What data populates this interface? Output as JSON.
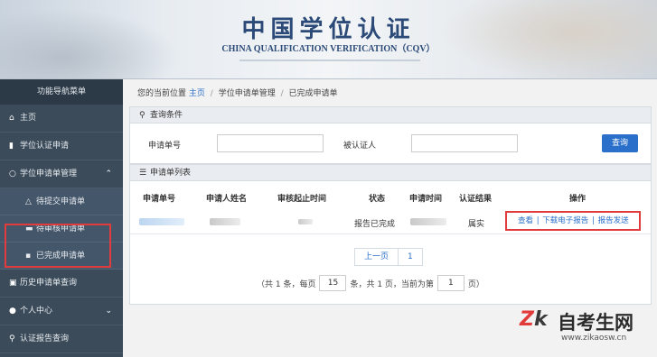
{
  "header": {
    "title_cn": "中国学位认证",
    "title_en": "CHINA QUALIFICATION VERIFICATION（CQV）"
  },
  "sidebar": {
    "heading": "功能导航菜单",
    "items": [
      {
        "label": "主页",
        "icon": "home-icon"
      },
      {
        "label": "学位认证申请",
        "icon": "document-icon"
      },
      {
        "label": "学位申请单管理",
        "icon": "circle-icon",
        "expanded": true
      },
      {
        "label": "历史申请单查询",
        "icon": "history-icon"
      },
      {
        "label": "个人中心",
        "icon": "user-icon"
      },
      {
        "label": "认证报告查询",
        "icon": "search-icon"
      }
    ],
    "subitems": [
      {
        "label": "待提交申请单",
        "icon": "warning-icon"
      },
      {
        "label": "待审核申请单",
        "icon": "pending-icon"
      },
      {
        "label": "已完成申请单",
        "icon": "done-icon"
      }
    ]
  },
  "breadcrumb": {
    "prefix": "您的当前位置",
    "home": "主页",
    "level2": "学位申请单管理",
    "current": "已完成申请单"
  },
  "query": {
    "panel_title": "查询条件",
    "field1_label": "申请单号",
    "field2_label": "被认证人",
    "button": "查询"
  },
  "list": {
    "panel_title": "申请单列表",
    "columns": [
      "申请单号",
      "申请人姓名",
      "审核起止时间",
      "状态",
      "申请时间",
      "认证结果",
      "操作"
    ],
    "row": {
      "status": "报告已完成",
      "result": "属实",
      "ops": [
        "查看",
        "下载电子报告",
        "报告发送"
      ]
    }
  },
  "pager": {
    "prev": "上一页",
    "current": "1",
    "info_a": "（共 1 条，每页",
    "per_page": "15",
    "info_b": "条，共 1 页，当前为第",
    "page": "1",
    "info_c": "页）"
  },
  "watermark": {
    "logo_a": "Z",
    "logo_b": "k",
    "name": "自考生网",
    "url": "www.zikaosw.cn"
  }
}
